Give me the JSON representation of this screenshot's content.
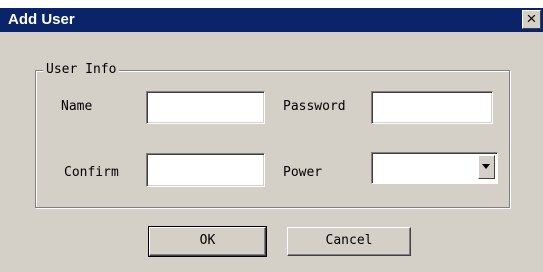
{
  "window": {
    "title": "Add User",
    "close_glyph": "×"
  },
  "group": {
    "legend": "User Info"
  },
  "fields": {
    "name_label": "Name",
    "name_value": "",
    "password_label": "Password",
    "password_value": "",
    "confirm_label": "Confirm",
    "confirm_value": "",
    "power_label": "Power",
    "power_value": ""
  },
  "buttons": {
    "ok_label": "OK",
    "cancel_label": "Cancel"
  },
  "colors": {
    "titlebar": "#0a246a",
    "face": "#d4d0c8"
  }
}
